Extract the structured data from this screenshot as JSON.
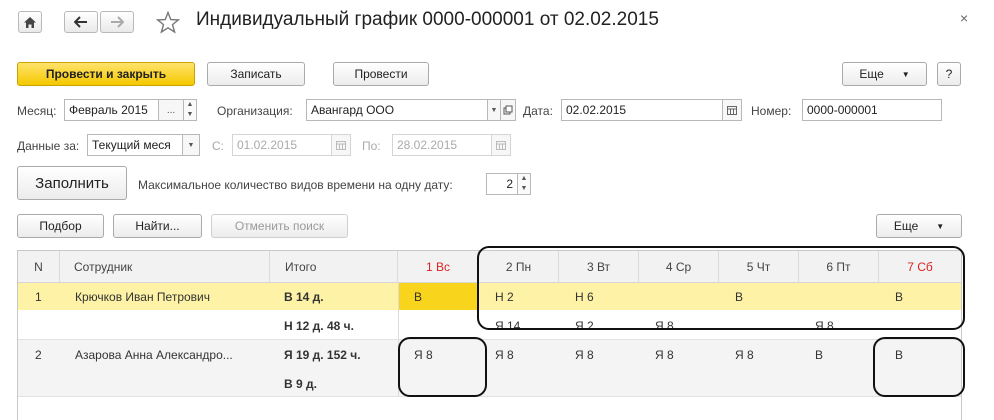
{
  "window": {
    "title": "Индивидуальный график 0000-000001 от 02.02.2015",
    "close": "×"
  },
  "toolbar": {
    "post_close": "Провести и закрыть",
    "save": "Записать",
    "post": "Провести",
    "more": "Еще",
    "help": "?"
  },
  "form": {
    "month_label": "Месяц:",
    "month_value": "Февраль 2015",
    "org_label": "Организация:",
    "org_value": "Авангард ООО",
    "date_label": "Дата:",
    "date_value": "02.02.2015",
    "number_label": "Номер:",
    "number_value": "0000-000001",
    "data_for_label": "Данные за:",
    "data_for_value": "Текущий меся",
    "from_label": "С:",
    "from_value": "01.02.2015",
    "to_label": "По:",
    "to_value": "28.02.2015",
    "fill_button": "Заполнить",
    "max_types_label": "Максимальное количество видов времени на одну дату:",
    "max_types_value": "2"
  },
  "table_toolbar": {
    "pick": "Подбор",
    "find": "Найти...",
    "cancel_search": "Отменить поиск",
    "more": "Еще"
  },
  "table": {
    "columns": {
      "n": "N",
      "employee": "Сотрудник",
      "total": "Итого",
      "days": [
        "1 Вс",
        "2 Пн",
        "3 Вт",
        "4 Ср",
        "5 Чт",
        "6 Пт",
        "7 Сб"
      ]
    },
    "rows": [
      {
        "n": "1",
        "employee": "Крючков Иван Петрович",
        "total1": "В 14 д.",
        "total2": "Н 12 д. 48 ч.",
        "line1": [
          "В",
          "Н 2",
          "Н 6",
          "",
          "В",
          "",
          "В"
        ],
        "line2": [
          "",
          "Я 14",
          "Я 2",
          "Я 8",
          "",
          "Я 8",
          ""
        ]
      },
      {
        "n": "2",
        "employee": "Азарова Анна Александро...",
        "total1": "Я 19 д. 152 ч.",
        "total2": "В 9 д.",
        "line1": [
          "Я 8",
          "Я 8",
          "Я 8",
          "Я 8",
          "Я 8",
          "В",
          "В"
        ],
        "line2": [
          "",
          "",
          "",
          "",
          "",
          "",
          ""
        ]
      }
    ]
  },
  "colors": {
    "primary_button": "#f5c800",
    "selected_row": "#fdf2a6",
    "selected_cell": "#f8d51c",
    "weekend": "#d22222"
  }
}
